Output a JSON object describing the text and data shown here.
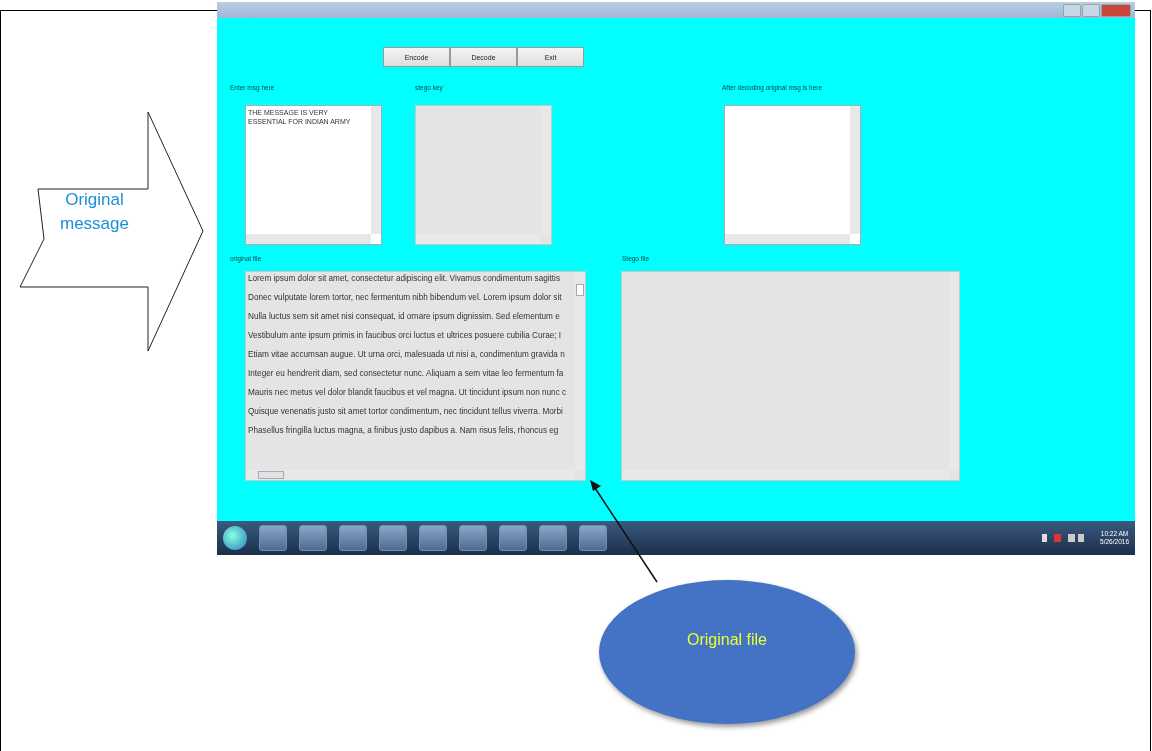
{
  "window": {
    "buttons": [
      {
        "label": "Encode"
      },
      {
        "label": "Decode"
      },
      {
        "label": "Exit"
      }
    ],
    "fields": [
      {
        "label": "Enter msg here",
        "value": "THE MESSAGE IS VERY\nESSENTIAL FOR INDIAN ARMY",
        "editable": true
      },
      {
        "label": "stego key",
        "editable": false
      },
      {
        "label": "After decoding original msg is here",
        "editable": true
      }
    ],
    "original_file": {
      "label": "original file",
      "editable": false,
      "lines": [
        "Lorem ipsum dolor sit amet, consectetur adipiscing elit. Vivamus condimentum sagittis",
        "Donec vulputate lorem tortor, nec fermentum nibh bibendum vel. Lorem ipsum dolor sit",
        "Nulla luctus sem sit amet nisi consequat, id ornare ipsum dignissim. Sed elementum e",
        "Vestibulum ante ipsum primis in faucibus orci luctus et ultrices posuere cubilia Curae; I",
        "Etiam vitae accumsan augue. Ut urna orci, malesuada ut nisi a, condimentum gravida n",
        "Integer eu hendrerit diam, sed consectetur nunc. Aliquam a sem vitae leo fermentum fa",
        "Mauris nec metus vel dolor blandit faucibus et vel magna. Ut tincidunt ipsum non nunc c",
        "Quisque venenatis justo sit amet tortor condimentum, nec tincidunt tellus viverra. Morbi",
        "Phasellus fringilla luctus magna, a finibus justo dapibus a. Nam risus felis, rhoncus eg"
      ]
    },
    "stego_file": {
      "label": "Stego file",
      "editable": false
    }
  },
  "taskbar": {
    "time": "10:22 AM",
    "date": "5/26/2016"
  },
  "annotations": [
    {
      "kind": "callout-arrow",
      "text": "Original\nmessage"
    },
    {
      "kind": "ellipse",
      "text": "Original file"
    }
  ]
}
